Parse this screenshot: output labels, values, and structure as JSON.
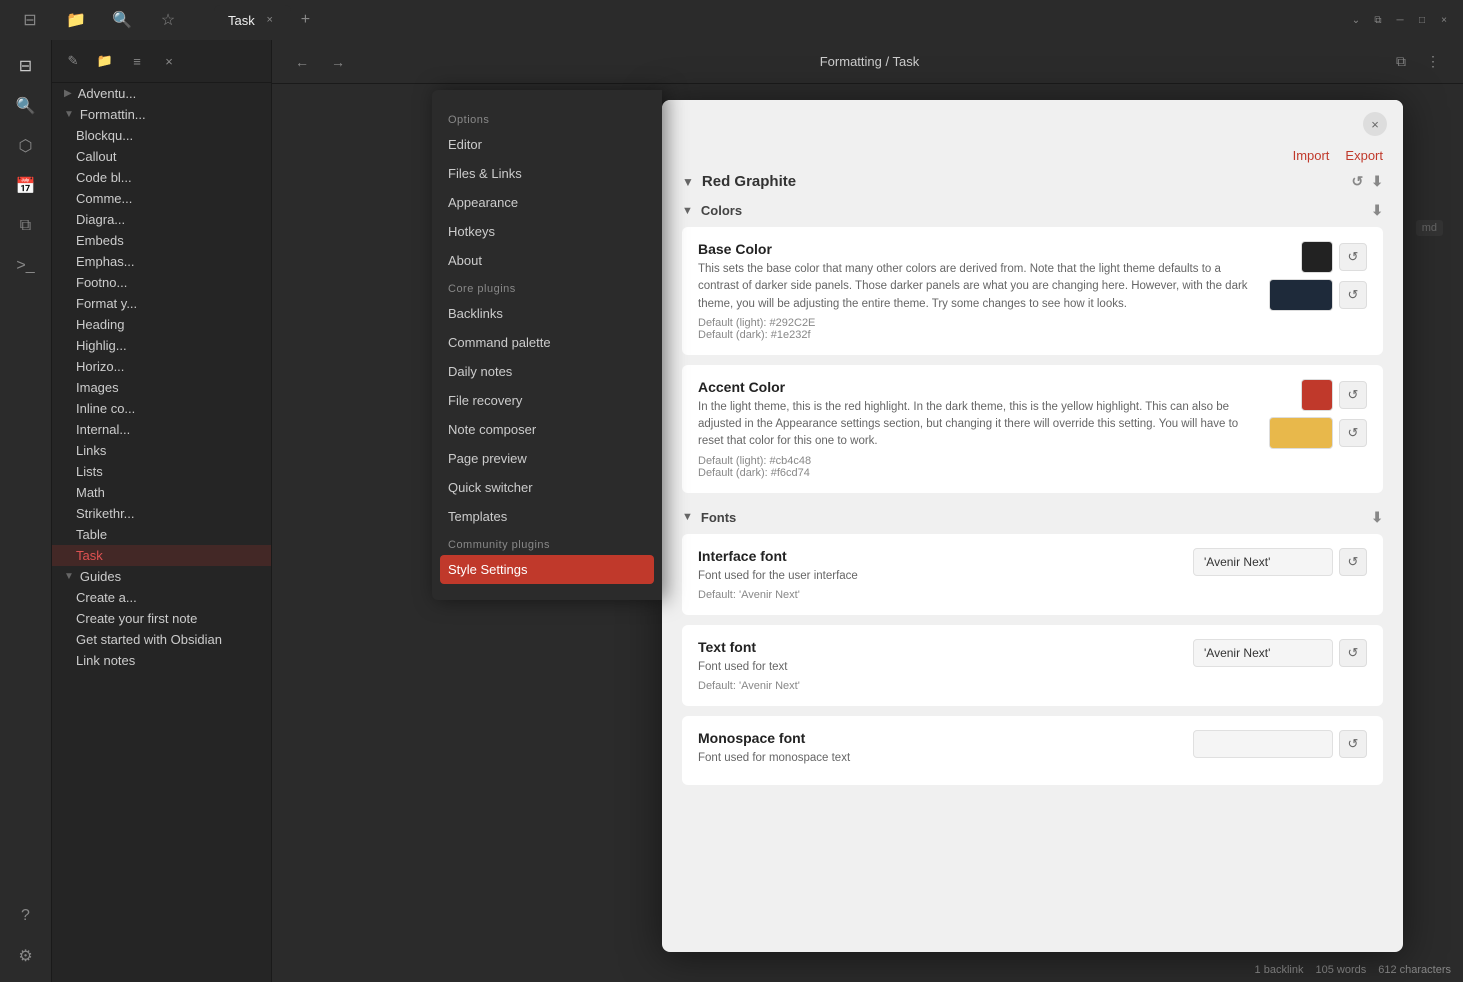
{
  "titlebar": {
    "tab_label": "Task",
    "tab_close": "×",
    "tab_add": "+",
    "nav_back": "←",
    "nav_forward": "→"
  },
  "breadcrumb": {
    "path": "Formatting",
    "separator": "/",
    "current": "Task"
  },
  "settings_menu": {
    "options_label": "Options",
    "options_items": [
      {
        "label": "Editor"
      },
      {
        "label": "Files & Links"
      },
      {
        "label": "Appearance"
      },
      {
        "label": "Hotkeys"
      },
      {
        "label": "About"
      }
    ],
    "core_plugins_label": "Core plugins",
    "core_plugins_items": [
      {
        "label": "Backlinks"
      },
      {
        "label": "Command palette"
      },
      {
        "label": "Daily notes"
      },
      {
        "label": "File recovery"
      },
      {
        "label": "Note composer"
      },
      {
        "label": "Page preview"
      },
      {
        "label": "Quick switcher"
      },
      {
        "label": "Templates"
      }
    ],
    "community_plugins_label": "Community plugins",
    "community_plugins_items": [
      {
        "label": "Style Settings",
        "active": true
      }
    ]
  },
  "plugin_panel": {
    "close_btn": "×",
    "import_btn": "Import",
    "export_btn": "Export",
    "section_title": "Red Graphite",
    "subsection_colors": "Colors",
    "base_color": {
      "title": "Base Color",
      "desc": "This sets the base color that many other colors are derived from. Note that the light theme defaults to a contrast of darker side panels. Those darker panels are what you are changing here. However, with the dark theme, you will be adjusting the entire theme. Try some changes to see how it looks.",
      "default_light": "Default (light): #292C2E",
      "default_dark": "Default (dark): #1e232f",
      "light_swatch_color": "#222",
      "dark_swatch_color": "#1e2a3a"
    },
    "accent_color": {
      "title": "Accent Color",
      "desc": "In the light theme, this is the red highlight. In the dark theme, this is the yellow highlight. This can also be adjusted in the Appearance settings section, but changing it there will override this setting. You will have to reset that color for this one to work.",
      "default_light": "Default (light): #cb4c48",
      "default_dark": "Default (dark): #f6cd74",
      "light_swatch_color": "#c0392b",
      "dark_swatch_color": "#e8b84b"
    },
    "subsection_fonts": "Fonts",
    "interface_font": {
      "title": "Interface font",
      "desc": "Font used for the user interface",
      "default": "Default: 'Avenir Next'",
      "value": "'Avenir Next'"
    },
    "text_font": {
      "title": "Text font",
      "desc": "Font used for text",
      "default": "Default: 'Avenir Next'",
      "value": "'Avenir Next'"
    },
    "monospace_font": {
      "title": "Monospace font",
      "desc": "Font used for monospace text",
      "default": "",
      "value": ""
    }
  },
  "file_tree": {
    "sections": [
      {
        "label": "Adventure",
        "collapsed": false,
        "items": []
      },
      {
        "label": "Formatting",
        "collapsed": false,
        "items": [
          {
            "label": "Blockqu..."
          },
          {
            "label": "Callout"
          },
          {
            "label": "Code bl..."
          },
          {
            "label": "Comme..."
          },
          {
            "label": "Diagra..."
          },
          {
            "label": "Embeds"
          },
          {
            "label": "Emphas..."
          },
          {
            "label": "Footno..."
          },
          {
            "label": "Format y..."
          },
          {
            "label": "Heading",
            "active": false
          },
          {
            "label": "Highlig..."
          },
          {
            "label": "Horizo..."
          },
          {
            "label": "Images"
          },
          {
            "label": "Inline co..."
          },
          {
            "label": "Internal..."
          },
          {
            "label": "Links"
          },
          {
            "label": "Lists"
          },
          {
            "label": "Math"
          },
          {
            "label": "Strikethr..."
          },
          {
            "label": "Table"
          },
          {
            "label": "Task",
            "active": true
          }
        ]
      },
      {
        "label": "Guides",
        "collapsed": false,
        "items": [
          {
            "label": "Create a..."
          },
          {
            "label": "Create your first note"
          },
          {
            "label": "Get started with Obsidian"
          },
          {
            "label": "Link notes"
          }
        ]
      }
    ]
  },
  "status_bar": {
    "backlink": "1 backlink",
    "words": "105 words",
    "chars": "612 characters"
  },
  "md_label": "md"
}
